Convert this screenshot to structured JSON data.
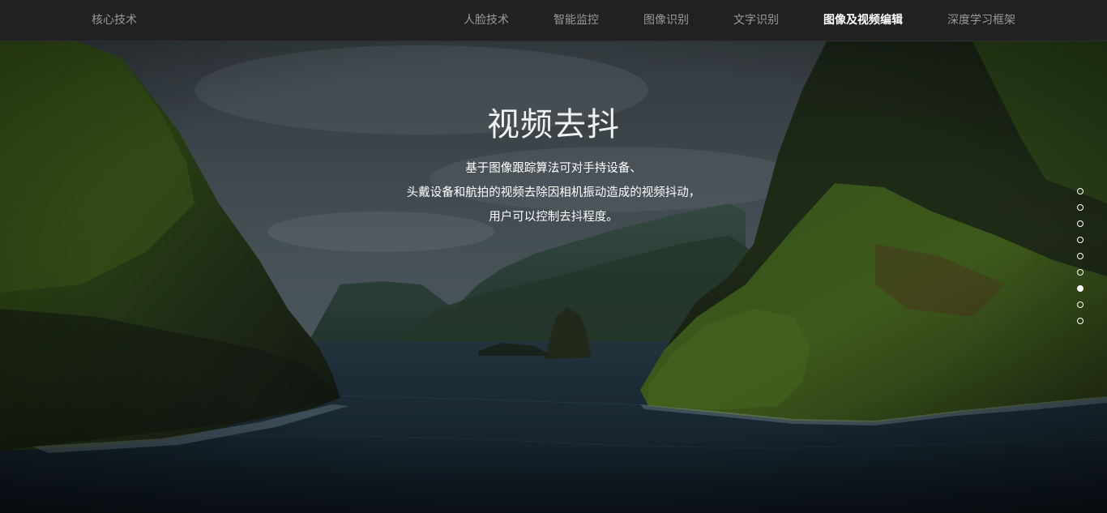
{
  "header": {
    "brand": "核心技术",
    "nav": [
      {
        "label": "人脸技术",
        "active": false
      },
      {
        "label": "智能监控",
        "active": false
      },
      {
        "label": "图像识别",
        "active": false
      },
      {
        "label": "文字识别",
        "active": false
      },
      {
        "label": "图像及视频编辑",
        "active": true
      },
      {
        "label": "深度学习框架",
        "active": false
      }
    ]
  },
  "hero": {
    "title": "视频去抖",
    "description": [
      "基于图像跟踪算法可对手持设备、",
      "头戴设备和航拍的视频去除因相机振动造成的视频抖动，",
      "用户可以控制去抖程度。"
    ]
  },
  "pagination": {
    "count": 9,
    "active_index": 6
  },
  "colors": {
    "topbar": "#212121",
    "nav_text": "#9a9a9a",
    "nav_active": "#ffffff"
  }
}
